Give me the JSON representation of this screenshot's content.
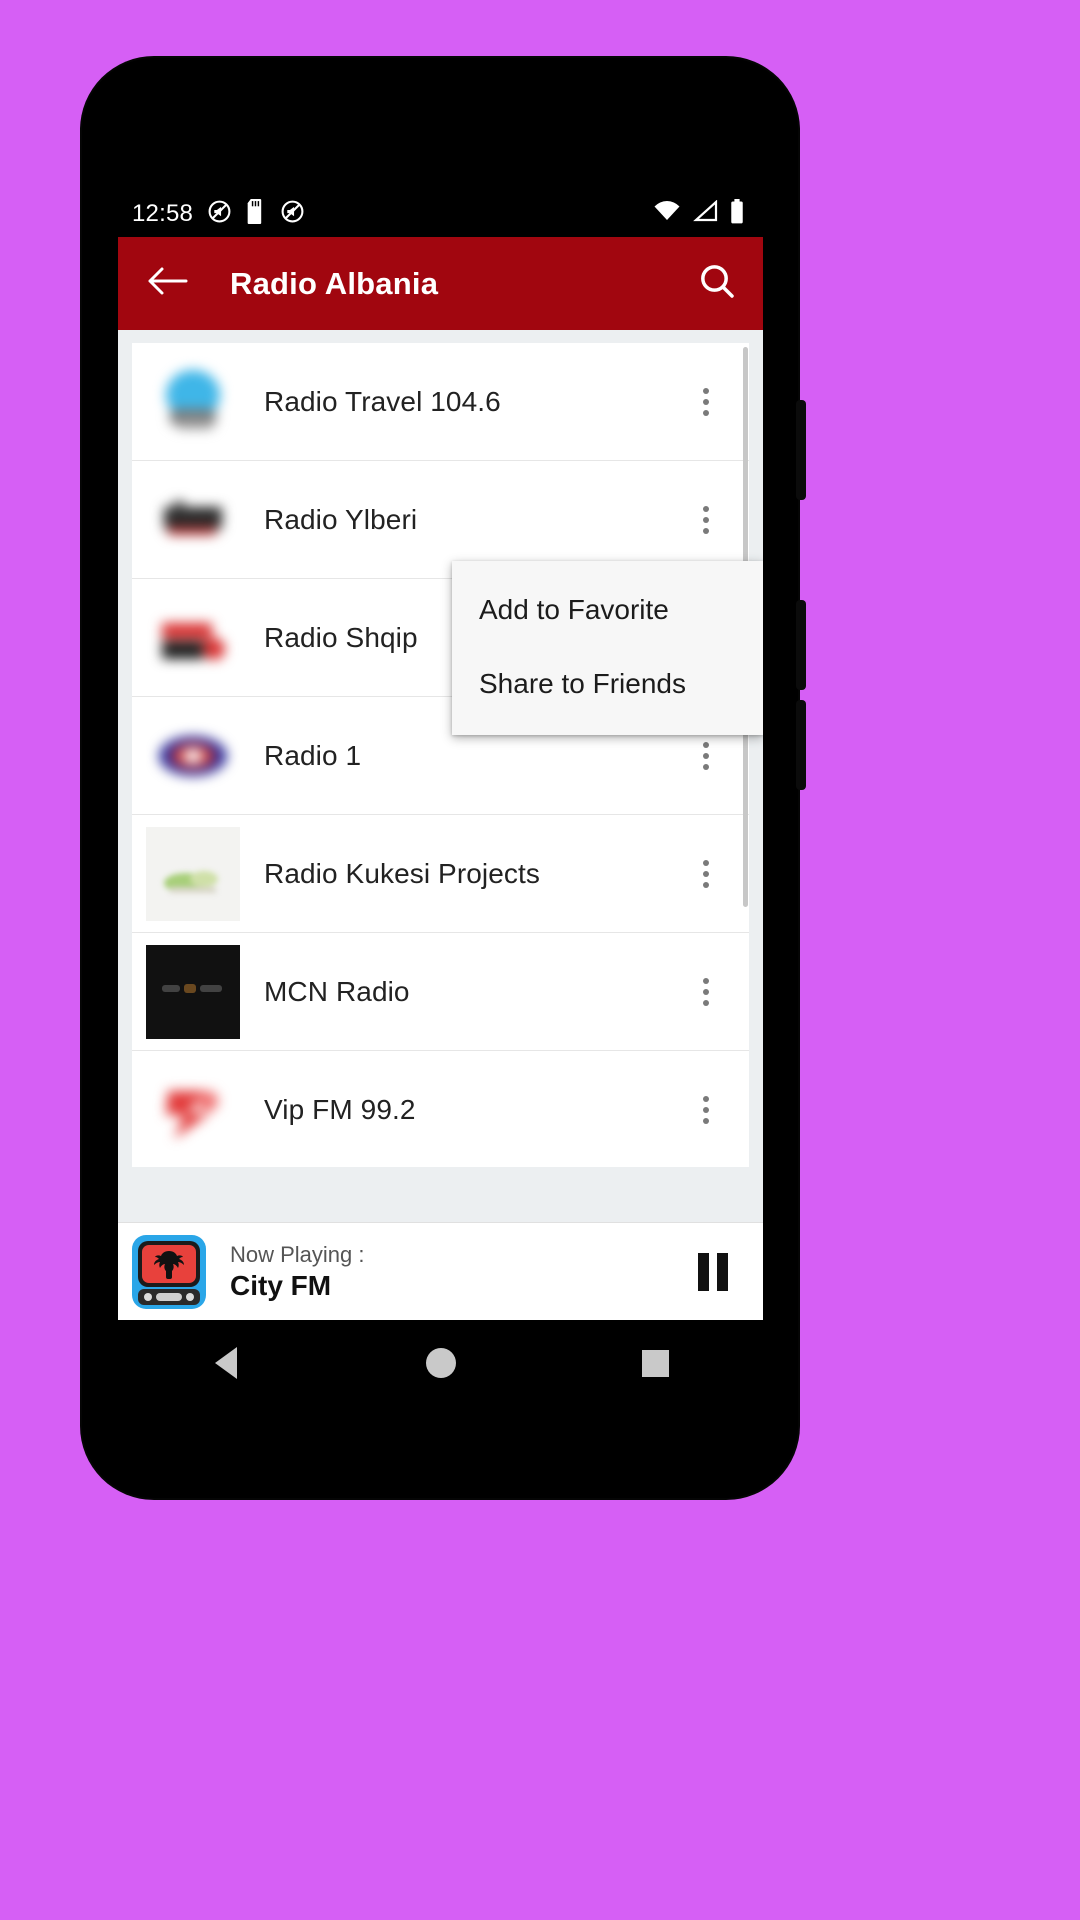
{
  "status_bar": {
    "time": "12:58",
    "left_icons": [
      "no-sound-icon",
      "sd-card-icon",
      "no-sound-icon"
    ],
    "right_icons": [
      "wifi-icon",
      "signal-icon",
      "battery-icon"
    ]
  },
  "app_bar": {
    "back_icon": "arrow-back-icon",
    "title": "Radio Albania",
    "search_icon": "search-icon",
    "background_color": "#A1060F",
    "title_color": "#FFFFFF"
  },
  "stations": [
    {
      "name": "Radio Travel 104.6",
      "logo": "blue-blob-logo",
      "overflow_icon": "more-vert-icon"
    },
    {
      "name": "Radio Ylberi",
      "logo": "dark-text-logo",
      "overflow_icon": "more-vert-icon"
    },
    {
      "name": "Radio Shqip",
      "logo": "red-black-logo",
      "overflow_icon": "more-vert-icon"
    },
    {
      "name": "Radio 1",
      "logo": "blue-red-oval-logo",
      "overflow_icon": "more-vert-icon"
    },
    {
      "name": "Radio Kukesi Projects",
      "logo": "green-pale-logo",
      "overflow_icon": "more-vert-icon"
    },
    {
      "name": "MCN Radio",
      "logo": "black-square-logo",
      "overflow_icon": "more-vert-icon"
    },
    {
      "name": "Vip FM 99.2",
      "logo": "red-pink-logo",
      "overflow_icon": "more-vert-icon"
    }
  ],
  "popup_menu": {
    "items": [
      {
        "label": "Add to Favorite"
      },
      {
        "label": "Share to Friends"
      }
    ],
    "background_color": "#F7F7F7"
  },
  "now_playing": {
    "label": "Now Playing :",
    "title": "City FM",
    "logo": "albanian-flag-radio-icon",
    "control_icon": "pause-icon"
  },
  "system_nav": {
    "back": "nav-back-icon",
    "home": "nav-home-icon",
    "recents": "nav-recents-icon"
  },
  "colors": {
    "background": "#D65FF5",
    "accent_red": "#A1060F",
    "list_background": "#ECEFF1"
  }
}
